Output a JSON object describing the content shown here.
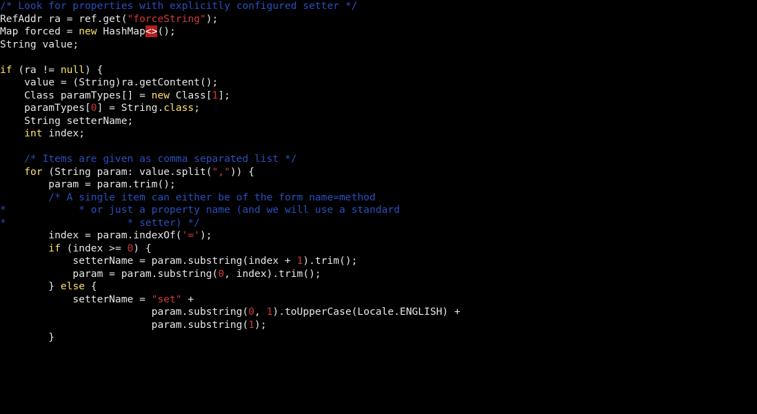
{
  "code": {
    "l1_comment": "/* Look for properties with explicitly configured setter */",
    "l2_a": "RefAddr ra = ref.get(",
    "l2_s": "\"forceString\"",
    "l2_b": ");",
    "l3_a": "Map forced = ",
    "l3_kw": "new",
    "l3_b": " HashMap",
    "l3_err": "<>",
    "l3_c": "();",
    "l4": "String value;",
    "l5": "",
    "l6_a": "if",
    "l6_b": " (ra != ",
    "l6_c": "null",
    "l6_d": ") {",
    "l7": "    value = (String)ra.getContent();",
    "l8_a": "    Class paramTypes[] = ",
    "l8_kw": "new",
    "l8_b": " Class[",
    "l8_n": "1",
    "l8_c": "];",
    "l9_a": "    paramTypes[",
    "l9_n": "0",
    "l9_b": "] = String.",
    "l9_kw": "class",
    "l9_c": ";",
    "l10": "    String setterName;",
    "l11_a": "    ",
    "l11_kw": "int",
    "l11_b": " index;",
    "l12": "",
    "l13_c": "    /* Items are given as comma separated list */",
    "l14_a": "    ",
    "l14_kw": "for",
    "l14_b": " (String param: value.split(",
    "l14_s": "\",\"",
    "l14_c": ")) {",
    "l15": "        param = param.trim();",
    "l16_c": "        /* A single item can either be of the form name=method",
    "l17_c": "*            * or just a property name (and we will use a standard",
    "l18_c": "*                    * setter) */",
    "l19_a": "        index = param.indexOf(",
    "l19_s": "'='",
    "l19_b": ");",
    "l20_a": "        ",
    "l20_kw": "if",
    "l20_b": " (index >= ",
    "l20_n": "0",
    "l20_c": ") {",
    "l21_a": "            setterName = param.substring(index + ",
    "l21_n": "1",
    "l21_b": ").trim();",
    "l22_a": "            param = param.substring(",
    "l22_n": "0",
    "l22_b": ", index).trim();",
    "l23_a": "        } ",
    "l23_kw": "else",
    "l23_b": " {",
    "l24_a": "            setterName = ",
    "l24_s": "\"set\"",
    "l24_b": " +",
    "l25_a": "                         param.substring(",
    "l25_n1": "0",
    "l25_b": ", ",
    "l25_n2": "1",
    "l25_c": ").toUpperCase(Locale.ENGLISH) +",
    "l26_a": "                         param.substring(",
    "l26_n": "1",
    "l26_b": ");",
    "l27": "        }"
  }
}
